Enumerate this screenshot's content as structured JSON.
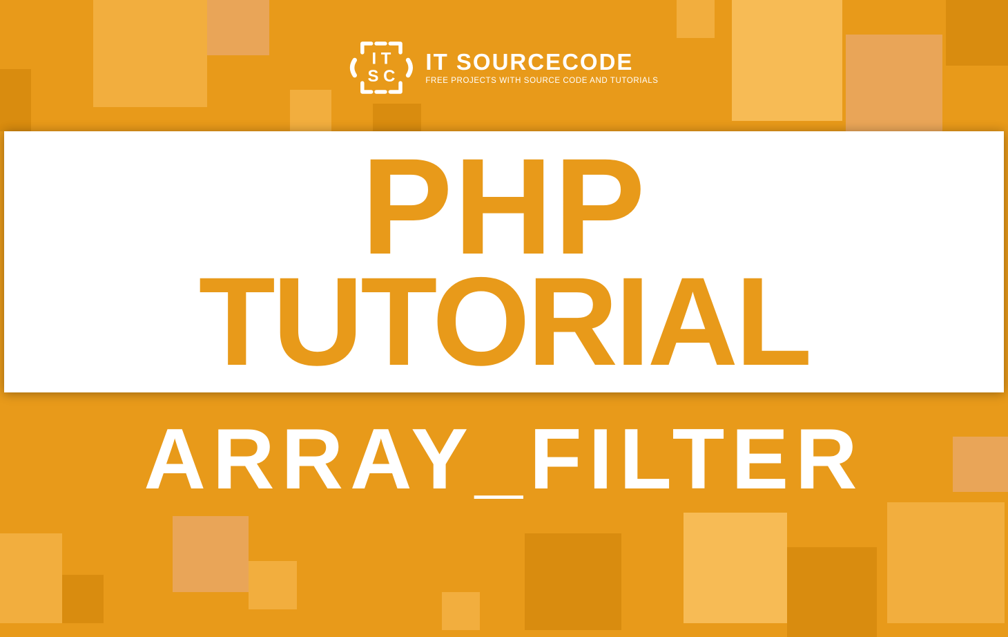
{
  "brand": {
    "name": "IT SOURCECODE",
    "tagline": "FREE PROJECTS WITH SOURCE CODE AND TUTORIALS"
  },
  "title": {
    "line1": "PHP",
    "line2": "TUTORIAL"
  },
  "subtitle": "ARRAY_FILTER",
  "colors": {
    "primary": "#e89a1a",
    "white": "#ffffff",
    "lightSquare": "#f2ae3e",
    "lighterSquare": "#f7bb55",
    "darkSquare": "#d98c0f",
    "pinkSquare": "#e9a558"
  }
}
